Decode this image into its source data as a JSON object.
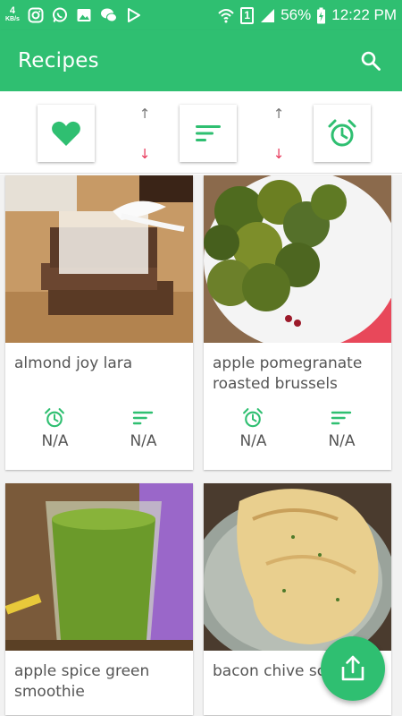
{
  "status_bar": {
    "net_speed": "4",
    "net_speed_unit": "KB/s",
    "sim_badge": "1",
    "battery_percent": "56%",
    "time": "12:22 PM"
  },
  "app_bar": {
    "title": "Recipes"
  },
  "colors": {
    "primary": "#2fbf71",
    "arrow_up": "#777777",
    "arrow_down": "#e8375a"
  },
  "sort_bar": {
    "items": [
      {
        "icon": "heart-icon"
      },
      {
        "icon": "sort-icon"
      },
      {
        "icon": "alarm-clock-icon"
      }
    ],
    "arrow_up": "↑",
    "arrow_down": "↓"
  },
  "recipes": [
    {
      "name": "almond joy lara",
      "time": "N/A",
      "difficulty": "N/A"
    },
    {
      "name": "apple pomegranate roasted brussels",
      "time": "N/A",
      "difficulty": "N/A"
    },
    {
      "name": "apple spice green smoothie",
      "time": "",
      "difficulty": ""
    },
    {
      "name": "bacon chive scones",
      "time": "",
      "difficulty": ""
    }
  ]
}
